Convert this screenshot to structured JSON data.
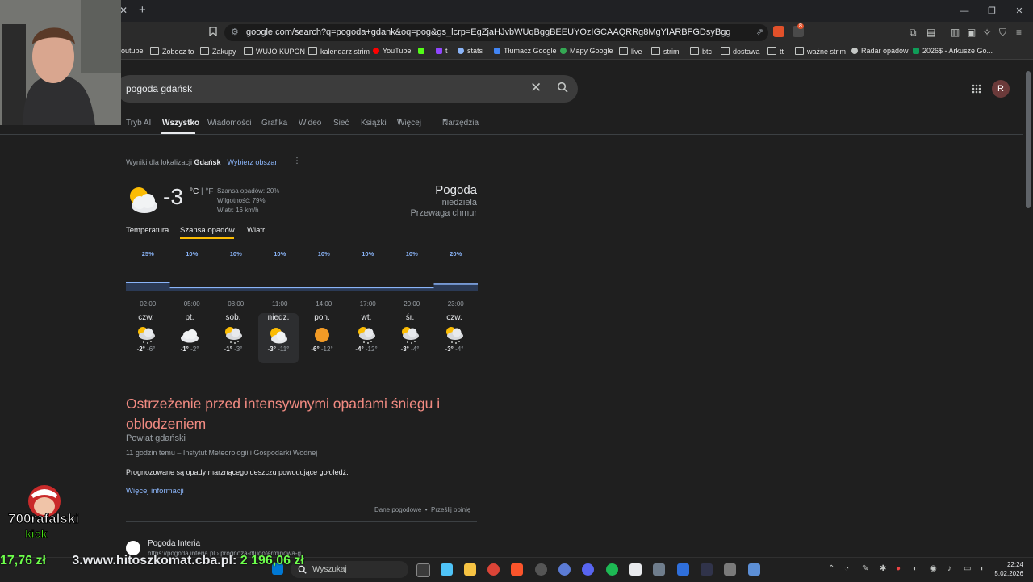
{
  "browser": {
    "url": "google.com/search?q=pogoda+gdank&oq=pog&gs_lcrp=EgZjaHJvbWUqBggBEEUYOzIGCAAQRRg8MgYIARBFGDsyBggCEEUYOTIGCAMQRRg7MgYI...",
    "tab_close_glyph": "✕",
    "new_tab_glyph": "+",
    "extension_badge": "8"
  },
  "bookmarks": [
    {
      "label": "outube",
      "icon": "youtube-icon"
    },
    {
      "label": "Zobocz to",
      "icon": "folder-icon"
    },
    {
      "label": "Zakupy",
      "icon": "folder-icon"
    },
    {
      "label": "WUJO KUPON",
      "icon": "folder-icon"
    },
    {
      "label": "kalendarz strim",
      "icon": "folder-icon"
    },
    {
      "label": "YouTube",
      "icon": "youtube-icon"
    },
    {
      "label": "",
      "icon": "kick-icon"
    },
    {
      "label": "t",
      "icon": "twitch-icon"
    },
    {
      "label": "stats",
      "icon": "stats-icon"
    },
    {
      "label": "Tłumacz Google",
      "icon": "translate-icon"
    },
    {
      "label": "Mapy Google",
      "icon": "maps-icon"
    },
    {
      "label": "live",
      "icon": "folder-icon"
    },
    {
      "label": "strim",
      "icon": "folder-icon"
    },
    {
      "label": "btc",
      "icon": "folder-icon"
    },
    {
      "label": "dostawa",
      "icon": "folder-icon"
    },
    {
      "label": "tt",
      "icon": "folder-icon"
    },
    {
      "label": "ważne strim",
      "icon": "folder-icon"
    },
    {
      "label": "Radar opadów",
      "icon": "radar-icon"
    },
    {
      "label": "2026$ - Arkusze Go...",
      "icon": "sheets-icon"
    }
  ],
  "search": {
    "query": "pogoda gdańsk",
    "avatar_letter": "R"
  },
  "nav_tabs": [
    "Tryb AI",
    "Wszystko",
    "Wiadomości",
    "Grafika",
    "Wideo",
    "Sieć",
    "Książki",
    "Więcej",
    "Narzędzia"
  ],
  "weather": {
    "location_prefix": "Wyniki dla lokalizacji",
    "location": "Gdańsk",
    "change_area": "Wybierz obszar",
    "temperature": "-3",
    "unit_c": "°C",
    "unit_sep": "|",
    "unit_f": "°F",
    "precip": "Szansa opadów: 20%",
    "humidity": "Wilgotność: 79%",
    "wind": "Wiatr: 16 km/h",
    "title": "Pogoda",
    "day": "niedziela",
    "condition": "Przewaga chmur",
    "tabs": [
      "Temperatura",
      "Szansa opadów",
      "Wiatr"
    ],
    "active_tab": "Szansa opadów",
    "forecast": [
      {
        "day": "czw.",
        "high": "-2°",
        "low": "-6°",
        "icon": "snow-cloud-sun-icon"
      },
      {
        "day": "pt.",
        "high": "-1°",
        "low": "-2°",
        "icon": "cloud-icon"
      },
      {
        "day": "sob.",
        "high": "-1°",
        "low": "-3°",
        "icon": "snow-cloud-sun-icon"
      },
      {
        "day": "niedz.",
        "high": "-3°",
        "low": "-11°",
        "icon": "cloud-sun-icon"
      },
      {
        "day": "pon.",
        "high": "-6°",
        "low": "-12°",
        "icon": "sun-icon"
      },
      {
        "day": "wt.",
        "high": "-4°",
        "low": "-12°",
        "icon": "snow-cloud-sun-icon"
      },
      {
        "day": "śr.",
        "high": "-3°",
        "low": "-4°",
        "icon": "snow-cloud-sun-icon"
      },
      {
        "day": "czw.",
        "high": "-3°",
        "low": "-4°",
        "icon": "snow-cloud-sun-icon"
      }
    ]
  },
  "chart_data": {
    "type": "area",
    "title": "",
    "xlabel": "",
    "ylabel": "",
    "x": [
      "02:00",
      "05:00",
      "08:00",
      "11:00",
      "14:00",
      "17:00",
      "20:00",
      "23:00"
    ],
    "series": [
      {
        "values": [
          25,
          10,
          10,
          10,
          10,
          10,
          10,
          20
        ]
      }
    ],
    "value_labels": [
      "25%",
      "10%",
      "10%",
      "10%",
      "10%",
      "10%",
      "10%",
      "20%"
    ],
    "ylim": [
      0,
      100
    ],
    "color": "#8ab4f8"
  },
  "warning": {
    "title": "Ostrzeżenie przed intensywnymi opadami śniegu i oblodzeniem",
    "area": "Powiat gdański",
    "source": "11 godzin temu – Instytut Meteorologii i Gospodarki Wodnej",
    "body": "Prognozowane są opady marznącego deszczu powodujące gołoledź.",
    "more": "Więcej informacji"
  },
  "footer_links": {
    "data": "Dane pogodowe",
    "sep": "•",
    "feedback": "Prześlij opinię"
  },
  "next_result": {
    "title": "Pogoda Interia",
    "url": "https://pogoda.interia.pl › prognoza-dlugoterminowa-g..."
  },
  "overlay": {
    "logo_text": "700rafalski",
    "logo_sub": "kick",
    "ticker_amount1": "17,76 zł",
    "ticker_text": "3.www.hitoszkomat.cba.pl:",
    "ticker_amount2": "2 196,06 zł"
  },
  "taskbar": {
    "search_placeholder": "Wyszukaj",
    "time": "22:24",
    "date": "5.02.2026"
  },
  "colors": {
    "accent_blue": "#8ab4f8",
    "warning_red": "#f28b82",
    "tab_yellow": "#fbbc04"
  }
}
